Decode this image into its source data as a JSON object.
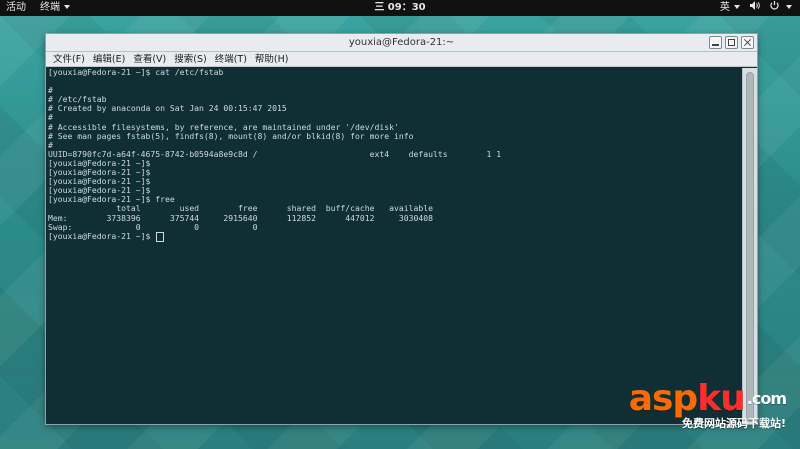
{
  "topbar": {
    "activities": "活动",
    "app_menu": "终端",
    "clock": "三 09：30",
    "input_method": "英",
    "volume_icon": "speaker-icon",
    "power_icon": "power-icon"
  },
  "window": {
    "title": "youxia@Fedora-21:~",
    "menu": [
      "文件(F)",
      "编辑(E)",
      "查看(V)",
      "搜索(S)",
      "终端(T)",
      "帮助(H)"
    ]
  },
  "terminal": {
    "lines": [
      "[youxia@Fedora-21 ~]$ cat /etc/fstab",
      "",
      "#",
      "# /etc/fstab",
      "# Created by anaconda on Sat Jan 24 00:15:47 2015",
      "#",
      "# Accessible filesystems, by reference, are maintained under '/dev/disk'",
      "# See man pages fstab(5), findfs(8), mount(8) and/or blkid(8) for more info",
      "#",
      "UUID=8790fc7d-a64f-4675-8742-b0594a8e9c8d /                       ext4    defaults        1 1",
      "[youxia@Fedora-21 ~]$",
      "[youxia@Fedora-21 ~]$",
      "[youxia@Fedora-21 ~]$",
      "[youxia@Fedora-21 ~]$",
      "[youxia@Fedora-21 ~]$ free",
      "              total        used        free      shared  buff/cache   available",
      "Mem:        3738396      375744     2915640      112852      447012     3030408",
      "Swap:             0           0           0"
    ],
    "prompt": "[youxia@Fedora-21 ~]$ "
  },
  "watermark": {
    "logo_main": "asp",
    "logo_ku": "ku",
    "logo_dot": ".com",
    "subtitle": "免费网站源码下载站!"
  }
}
